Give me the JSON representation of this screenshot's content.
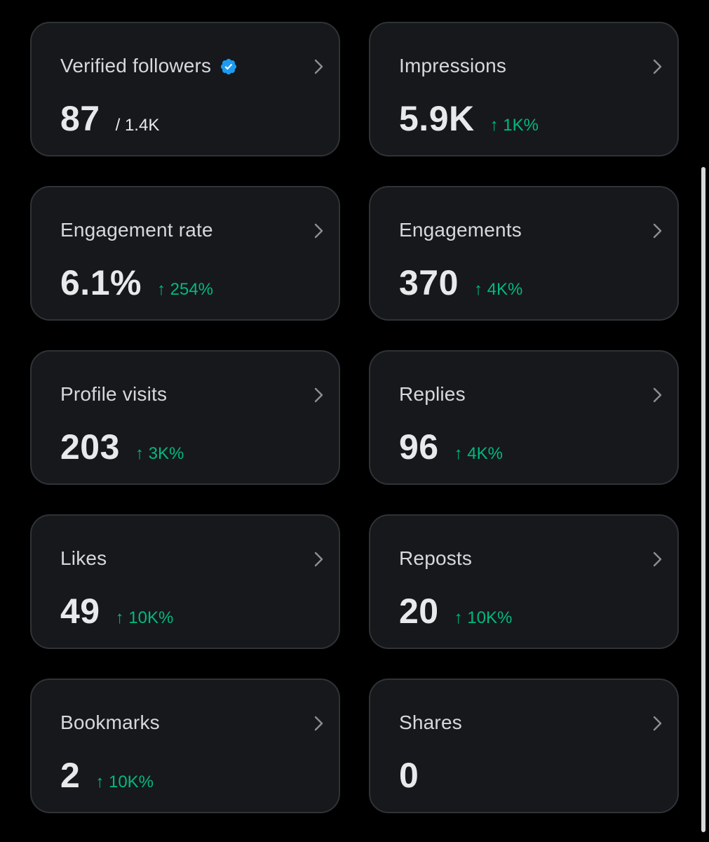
{
  "cards": [
    {
      "title": "Verified followers",
      "value": "87",
      "sub": "/ 1.4K",
      "change": ""
    },
    {
      "title": "Impressions",
      "value": "5.9K",
      "sub": "",
      "change": "↑ 1K%"
    },
    {
      "title": "Engagement rate",
      "value": "6.1%",
      "sub": "",
      "change": "↑ 254%"
    },
    {
      "title": "Engagements",
      "value": "370",
      "sub": "",
      "change": "↑ 4K%"
    },
    {
      "title": "Profile visits",
      "value": "203",
      "sub": "",
      "change": "↑ 3K%"
    },
    {
      "title": "Replies",
      "value": "96",
      "sub": "",
      "change": "↑ 4K%"
    },
    {
      "title": "Likes",
      "value": "49",
      "sub": "",
      "change": "↑ 10K%"
    },
    {
      "title": "Reposts",
      "value": "20",
      "sub": "",
      "change": "↑ 10K%"
    },
    {
      "title": "Bookmarks",
      "value": "2",
      "sub": "",
      "change": "↑ 10K%"
    },
    {
      "title": "Shares",
      "value": "0",
      "sub": "",
      "change": ""
    }
  ],
  "icons": {
    "verified": "verified-badge-icon",
    "chevron": "chevron-right-icon"
  },
  "colors": {
    "background": "#000000",
    "card_background": "#16181c",
    "card_border": "#2f3336",
    "positive_change": "#00ba7c",
    "verified_badge": "#1d9bf0",
    "scrollbar": "#d9d9d9"
  }
}
